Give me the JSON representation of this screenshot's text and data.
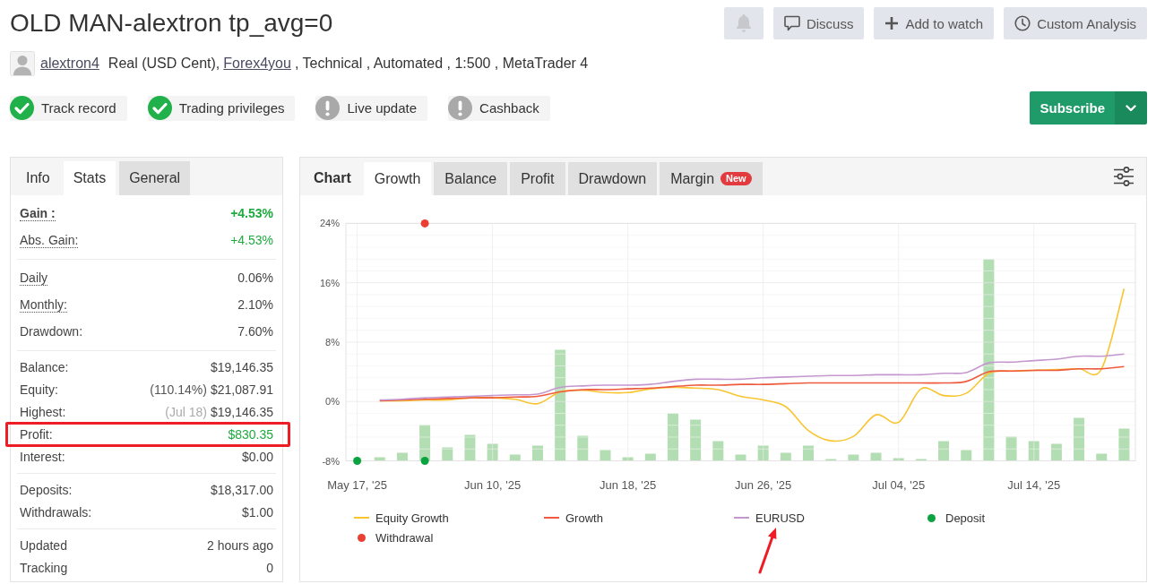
{
  "title": "OLD MAN-alextron tp_avg=0",
  "actions": [
    {
      "kind": "notify"
    },
    {
      "kind": "discuss",
      "label": "Discuss"
    },
    {
      "kind": "watch",
      "label": "Add to watch"
    },
    {
      "kind": "analysis",
      "label": "Custom Analysis"
    }
  ],
  "account": {
    "user": "alextron4",
    "parts": [
      {
        "kind": "text",
        "text": "Real (USD Cent),"
      },
      {
        "kind": "link",
        "text": "Forex4you"
      },
      {
        "kind": "text",
        "text": ", Technical , Automated , 1:500 , MetaTrader 4"
      }
    ]
  },
  "badges": [
    {
      "label": "Track record",
      "verified": true
    },
    {
      "label": "Trading privileges",
      "verified": true
    },
    {
      "label": "Live update",
      "verified": false
    },
    {
      "label": "Cashback",
      "verified": false
    }
  ],
  "subscribe": {
    "label": "Subscribe"
  },
  "stats_panel": {
    "title": "Info",
    "tabs": [
      {
        "label": "Stats",
        "selected": true
      },
      {
        "label": "General",
        "selected": false
      }
    ],
    "groups": [
      {
        "rows": [
          {
            "label": "Gain :",
            "value": "+4.53%",
            "dotted": true,
            "bold": true,
            "positive": true,
            "highlighted": false
          },
          {
            "label": "Abs. Gain:",
            "value": "+4.53%",
            "dotted": true,
            "bold": false,
            "positive": true,
            "highlighted": false
          }
        ]
      },
      {
        "rows": [
          {
            "label": "Daily",
            "value": "0.06%",
            "dotted": true,
            "bold": false,
            "positive": false,
            "highlighted": false
          },
          {
            "label": "Monthly:",
            "value": "2.10%",
            "dotted": true,
            "bold": false,
            "positive": false,
            "highlighted": false
          },
          {
            "label": "Drawdown:",
            "value": "7.60%",
            "dotted": false,
            "bold": false,
            "positive": false,
            "highlighted": false
          }
        ]
      },
      {
        "rows": [
          {
            "label": "Balance:",
            "value": "$19,146.35",
            "dotted": false,
            "bold": false,
            "positive": false,
            "highlighted": false
          },
          {
            "label": "Equity:",
            "prefix": "(110.14%)",
            "prefix_muted": false,
            "value": "$21,087.91",
            "dotted": false,
            "bold": false,
            "positive": false,
            "highlighted": false
          },
          {
            "label": "Highest:",
            "prefix": "(Jul 18)",
            "prefix_muted": true,
            "value": "$19,146.35",
            "dotted": false,
            "bold": false,
            "positive": false,
            "highlighted": false
          },
          {
            "label": "Profit:",
            "value": "$830.35",
            "dotted": false,
            "bold": false,
            "positive": true,
            "highlighted": true
          },
          {
            "label": "Interest:",
            "value": "$0.00",
            "dotted": false,
            "bold": false,
            "positive": false,
            "highlighted": false
          }
        ]
      },
      {
        "rows": [
          {
            "label": "Deposits:",
            "value": "$18,317.00",
            "dotted": false,
            "bold": false,
            "positive": false,
            "highlighted": false
          },
          {
            "label": "Withdrawals:",
            "value": "$1.00",
            "dotted": false,
            "bold": false,
            "positive": false,
            "highlighted": false
          }
        ]
      },
      {
        "rows": [
          {
            "label": "Updated",
            "value": "2 hours ago",
            "dotted": false,
            "bold": false,
            "positive": false,
            "highlighted": false
          },
          {
            "label": "Tracking",
            "value": "0",
            "dotted": false,
            "bold": false,
            "positive": false,
            "highlighted": false
          }
        ]
      }
    ]
  },
  "chart_panel": {
    "title": "Chart",
    "tabs": [
      {
        "label": "Growth",
        "selected": true
      },
      {
        "label": "Balance",
        "selected": false
      },
      {
        "label": "Profit",
        "selected": false
      },
      {
        "label": "Drawdown",
        "selected": false
      },
      {
        "label": "Margin",
        "selected": false,
        "badge": "New"
      }
    ],
    "chart_data": {
      "type": "line",
      "categories": [
        "May 17, '25",
        null,
        null,
        null,
        null,
        null,
        "Jun 10, '25",
        null,
        null,
        null,
        null,
        null,
        "Jun 18, '25",
        null,
        null,
        null,
        null,
        null,
        "Jun 26, '25",
        null,
        null,
        null,
        null,
        null,
        "Jul 04, '25",
        null,
        null,
        null,
        null,
        null,
        "Jul 14, '25",
        null,
        null,
        null,
        null
      ],
      "ylim": [
        -8,
        24
      ],
      "grid": true,
      "yticks": [
        {
          "value": -8,
          "label": "-8%"
        },
        {
          "value": 0,
          "label": "0%"
        },
        {
          "value": 8,
          "label": "8%"
        },
        {
          "value": 16,
          "label": "16%"
        },
        {
          "value": 24,
          "label": "24%"
        }
      ],
      "series": [
        {
          "name": "Equity Growth",
          "color": "#f8c531",
          "values": [
            null,
            0.1,
            0.1,
            0.2,
            0.2,
            0.5,
            0.5,
            0.3,
            -0.3,
            1.3,
            1.5,
            1.2,
            1.2,
            1.7,
            1.9,
            1.8,
            1.6,
            0.7,
            0.2,
            -0.7,
            -3.9,
            -5.3,
            -4.7,
            -1.8,
            -2.8,
            1.7,
            0.8,
            1.1,
            3.8,
            4.1,
            4.2,
            4.3,
            4.4,
            4.4,
            15.2
          ]
        },
        {
          "name": "Growth",
          "color": "#f05a3c",
          "values": [
            null,
            0.1,
            0.2,
            0.3,
            0.4,
            0.5,
            0.5,
            0.6,
            0.7,
            1.3,
            1.6,
            1.6,
            1.7,
            1.8,
            2.0,
            2.2,
            2.2,
            2.3,
            2.3,
            2.4,
            2.5,
            2.5,
            2.5,
            2.5,
            2.5,
            2.5,
            2.5,
            2.7,
            4.0,
            4.1,
            4.2,
            4.2,
            4.4,
            4.4,
            4.7
          ]
        },
        {
          "name": "EURUSD",
          "color": "#c497cf",
          "values": [
            null,
            0.2,
            0.3,
            0.5,
            0.6,
            0.7,
            0.8,
            0.9,
            1.0,
            1.9,
            2.1,
            2.2,
            2.2,
            2.3,
            2.7,
            3.0,
            3.0,
            3.0,
            3.2,
            3.3,
            3.4,
            3.5,
            3.5,
            3.6,
            3.6,
            3.6,
            3.8,
            3.9,
            5.2,
            5.3,
            5.5,
            5.7,
            6.1,
            6.1,
            6.4
          ]
        },
        {
          "name": "Deposit",
          "type": "scatter",
          "color": "#0ba33f",
          "values": [
            -8,
            null,
            null,
            -8,
            null,
            null,
            null,
            null,
            null,
            null,
            null,
            null,
            null,
            null,
            null,
            null,
            null,
            null,
            null,
            null,
            null,
            null,
            null,
            null,
            null,
            null,
            null,
            null,
            null,
            null,
            null,
            null,
            null,
            null,
            null
          ]
        },
        {
          "name": "Withdrawal",
          "type": "scatter",
          "color": "#ea3f33",
          "values": [
            null,
            null,
            null,
            24,
            null,
            null,
            null,
            null,
            null,
            null,
            null,
            null,
            null,
            null,
            null,
            null,
            null,
            null,
            null,
            null,
            null,
            null,
            null,
            null,
            null,
            null,
            null,
            null,
            null,
            null,
            null,
            null,
            null,
            null,
            null
          ]
        }
      ]
    },
    "legend_arrow": true
  }
}
